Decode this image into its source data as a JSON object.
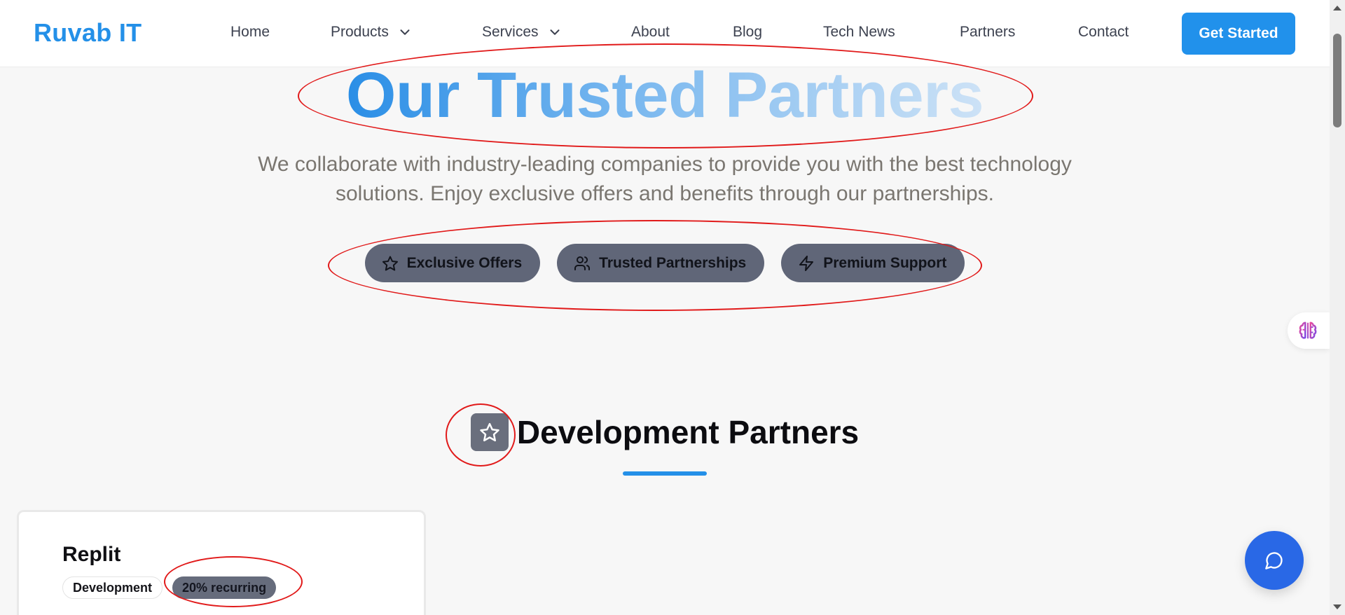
{
  "header": {
    "logo": "Ruvab IT",
    "nav": [
      {
        "label": "Home"
      },
      {
        "label": "Products"
      },
      {
        "label": "Services"
      },
      {
        "label": "About"
      },
      {
        "label": "Blog"
      },
      {
        "label": "Tech News"
      },
      {
        "label": "Partners"
      },
      {
        "label": "Contact"
      }
    ],
    "cta_label": "Get Started"
  },
  "hero": {
    "title": "Our Trusted Partners",
    "subtitle_line1": "We collaborate with industry-leading companies to provide you with the best technology",
    "subtitle_line2": "solutions. Enjoy exclusive offers and benefits through our partnerships.",
    "features": [
      {
        "label": "Exclusive Offers",
        "icon": "star-icon"
      },
      {
        "label": "Trusted Partnerships",
        "icon": "users-icon"
      },
      {
        "label": "Premium Support",
        "icon": "lightning-icon"
      }
    ]
  },
  "section": {
    "icon": "star-icon",
    "title": "Development Partners"
  },
  "cards": [
    {
      "name": "Replit",
      "category": "Development",
      "commission": "20% recurring"
    }
  ],
  "floating": {
    "ai_icon": "brain-icon",
    "chat_icon": "chat-bubble-icon"
  },
  "colors": {
    "brand": "#2490e8",
    "pill_bg": "#606678",
    "annotation": "#e11a1a",
    "chat_button": "#2968e6"
  }
}
